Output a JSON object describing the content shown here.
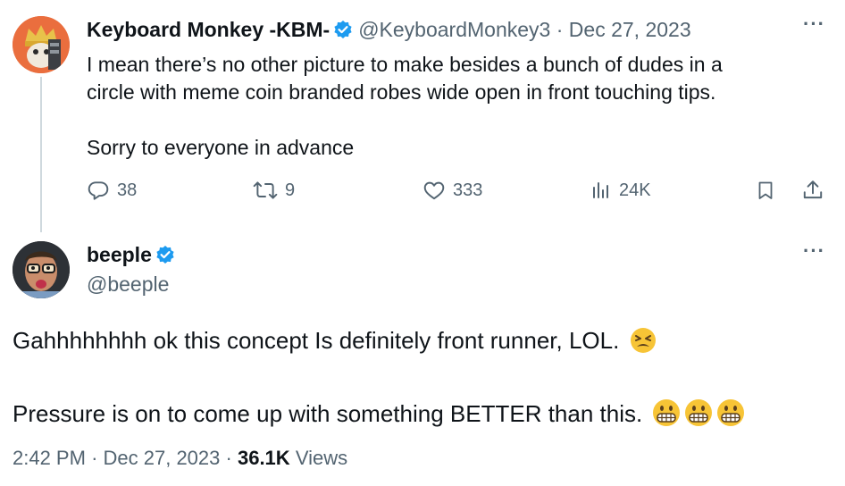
{
  "reply_tweet": {
    "author_name": "Keyboard Monkey -KBM-",
    "handle": "@KeyboardMonkey3",
    "separator": "·",
    "date": "Dec 27, 2023",
    "more_label": "···",
    "text_line1": "I mean there’s no other picture to make besides a bunch of dudes in a",
    "text_line2": "circle with meme coin branded robes wide open in front touching tips.",
    "text_line3": "Sorry to everyone in advance",
    "replies": "38",
    "reposts": "9",
    "likes": "333",
    "views": "24K"
  },
  "main_tweet": {
    "author_name": "beeple",
    "handle": "@beeple",
    "more_label": "···",
    "text_line1": "Gahhhhhhhh ok this concept Is definitely front runner, LOL.",
    "text_line2": "Pressure is on to come up with something BETTER than this.",
    "time": "2:42 PM",
    "separator": "·",
    "date": "Dec 27, 2023",
    "separator2": "·",
    "views_count": "36.1K",
    "views_label": "Views"
  },
  "colors": {
    "verified": "#1d9bf0",
    "muted": "#536471",
    "kbm_avatar_bg": "#ea6e3e",
    "emoji_yellow": "#f7c436"
  },
  "icons": [
    "verified-badge-icon",
    "more-icon",
    "reply-icon",
    "repost-icon",
    "like-icon",
    "views-icon",
    "bookmark-icon",
    "share-icon",
    "tired-face-emoji",
    "grimacing-face-emoji"
  ]
}
